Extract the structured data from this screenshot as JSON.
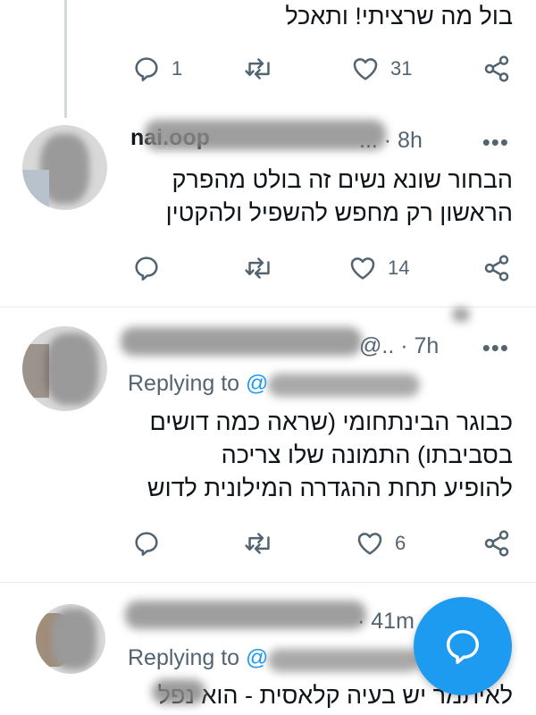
{
  "tweets": [
    {
      "text_lines": [
        "בול מה שרציתי! ותאכל"
      ],
      "reply_count": "1",
      "retweet_count": "",
      "like_count": "31"
    },
    {
      "name_fragment": "nai.oop",
      "handle_fragment": "... · 8h",
      "text_lines": [
        "הבחור שונא נשים זה בולט מהפרק",
        "הראשון רק מחפש להשפיל ולהקטין"
      ],
      "reply_count": "",
      "retweet_count": "",
      "like_count": "14"
    },
    {
      "handle_fragment": "@.. · 7h",
      "replying_label": "Replying to",
      "replying_at": "@",
      "text_lines": [
        "כבוגר הבינתחומי (שראה כמה דושים",
        "בסביבתו) התמונה שלו צריכה",
        "להופיע תחת ההגדרה המילונית לדוש"
      ],
      "reply_count": "",
      "retweet_count": "",
      "like_count": "6"
    },
    {
      "handle_fragment": "· 41m",
      "replying_label": "Replying to",
      "replying_at": "@",
      "text_lines": [
        "לאיתמר יש בעיה קלאסית - הוא נפל"
      ]
    }
  ],
  "more_label": "•••",
  "fab_icon": "compose-reply-icon",
  "colors": {
    "accent": "#1d9bf0",
    "secondary_text": "#536471",
    "divider": "#e6ecf0"
  }
}
